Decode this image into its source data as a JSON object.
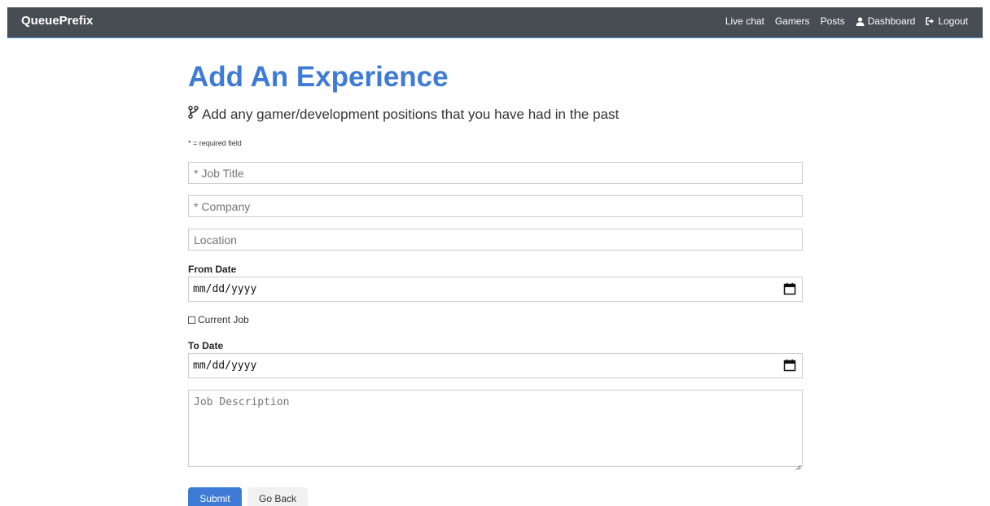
{
  "navbar": {
    "brand": "QueuePrefix",
    "links": [
      {
        "label": "Live chat"
      },
      {
        "label": "Gamers"
      },
      {
        "label": "Posts"
      },
      {
        "label": "Dashboard",
        "icon": "user-icon"
      },
      {
        "label": "Logout",
        "icon": "sign-out-icon"
      }
    ]
  },
  "main": {
    "title": "Add An Experience",
    "lead": "Add any gamer/development positions that you have had in the past",
    "lead_icon": "code-branch-icon",
    "required_note": "* = required field"
  },
  "form": {
    "job_title": {
      "placeholder": "* Job Title",
      "value": ""
    },
    "company": {
      "placeholder": "* Company",
      "value": ""
    },
    "location": {
      "placeholder": "Location",
      "value": ""
    },
    "from_date": {
      "label": "From Date",
      "value": "mm/dd/yyyy"
    },
    "current_job": {
      "label": "Current Job",
      "checked": false
    },
    "to_date": {
      "label": "To Date",
      "value": "mm/dd/yyyy"
    },
    "description": {
      "placeholder": "Job Description",
      "value": ""
    },
    "submit_label": "Submit",
    "back_label": "Go Back"
  },
  "colors": {
    "navbar_bg": "#343a40",
    "accent": "#3d7bd6",
    "light_button": "#f1f1f1"
  }
}
